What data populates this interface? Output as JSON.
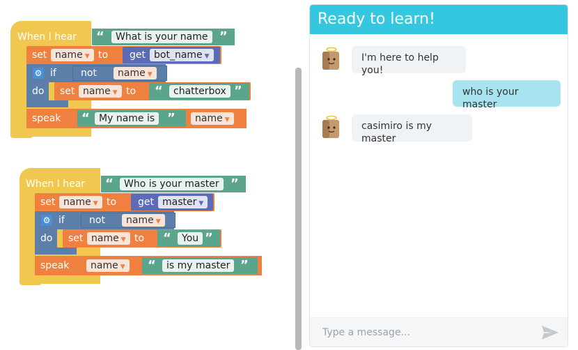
{
  "workspace": {
    "block1": {
      "when_label": "When I hear",
      "phrase": "What is your name",
      "set1_label": "set",
      "set1_var": "name",
      "to1_label": "to",
      "get_label": "get",
      "get_var": "bot_name",
      "if_label": "if",
      "not_label": "not",
      "not_var": "name",
      "do_label": "do",
      "set2_label": "set",
      "set2_var": "name",
      "to2_label": "to",
      "set2_value": "chatterbox",
      "speak_label": "speak",
      "speak_text": "My name is",
      "speak_var": "name"
    },
    "block2": {
      "when_label": "When I hear",
      "phrase": "Who is your master",
      "set1_label": "set",
      "set1_var": "name",
      "to1_label": "to",
      "get_label": "get",
      "get_var": "master",
      "if_label": "if",
      "not_label": "not",
      "not_var": "name",
      "do_label": "do",
      "set2_label": "set",
      "set2_var": "name",
      "to2_label": "to",
      "set2_value": "You",
      "speak_label": "speak",
      "speak_var": "name",
      "speak_text": "is my master"
    }
  },
  "chat": {
    "title": "Ready to learn!",
    "messages": [
      {
        "from": "bot",
        "text": "I'm here to help you!"
      },
      {
        "from": "user",
        "text": "who is your master"
      },
      {
        "from": "bot",
        "text": "casimiro is my master"
      }
    ],
    "input_placeholder": "Type a message...",
    "send_icon": "send-icon",
    "avatar_icon": "robot-avatar-icon"
  }
}
